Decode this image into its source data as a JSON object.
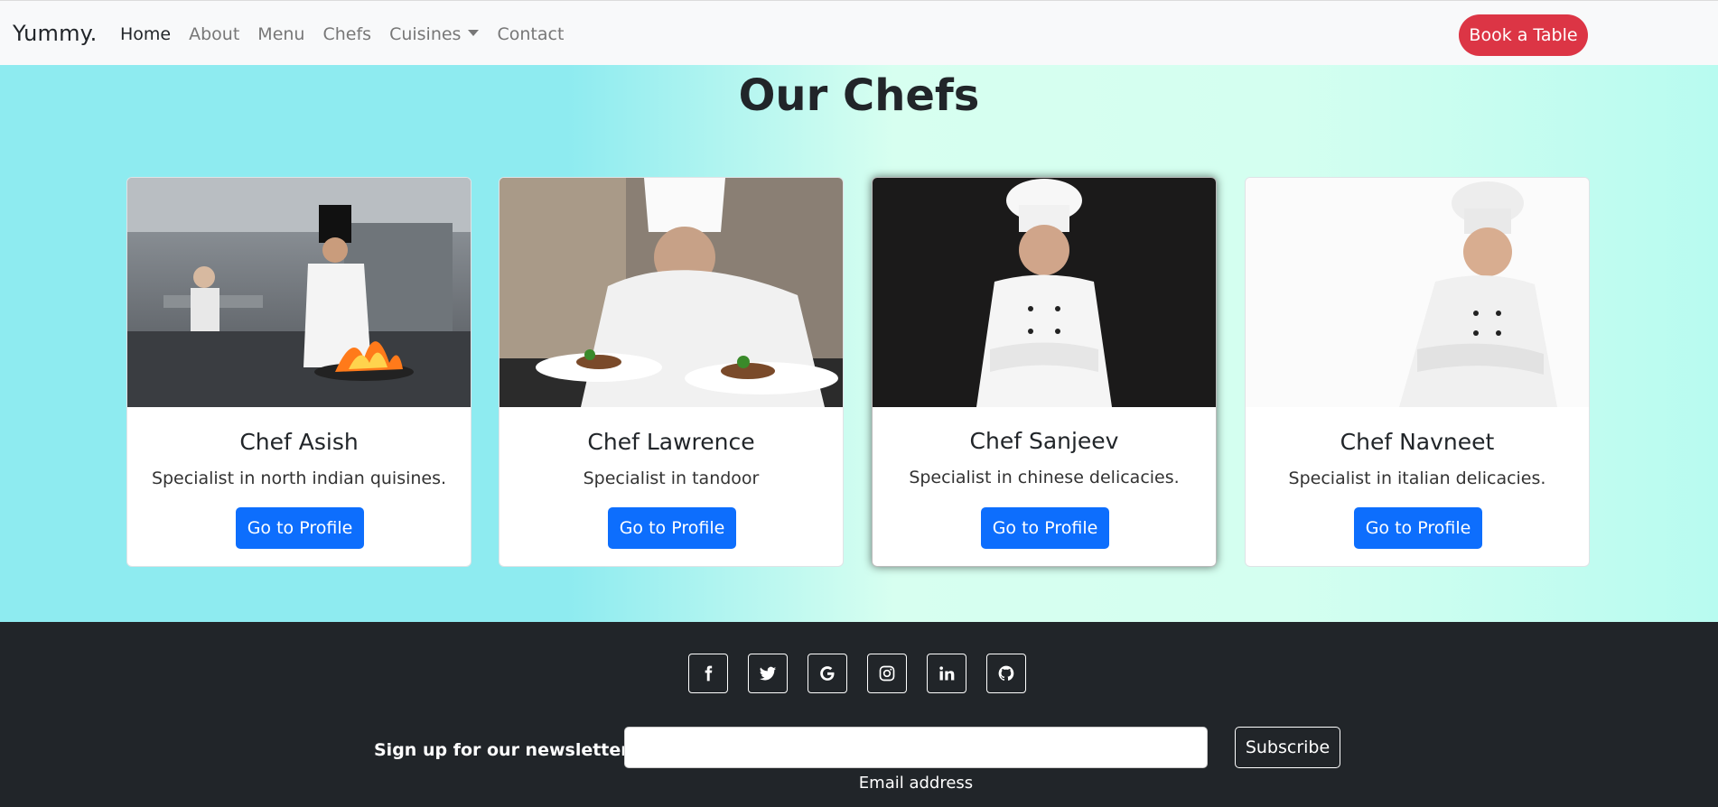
{
  "navbar": {
    "brand": "Yummy.",
    "items": [
      {
        "label": "Home"
      },
      {
        "label": "About"
      },
      {
        "label": "Menu"
      },
      {
        "label": "Chefs"
      },
      {
        "label": "Cuisines"
      },
      {
        "label": "Contact"
      }
    ],
    "book_label": "Book a Table"
  },
  "chefs": {
    "title": "Our Chefs",
    "cards": [
      {
        "name": "Chef Asish",
        "desc": "Specialist in north indian quisines.",
        "button": "Go to Profile",
        "image": "chef cooking with flames in a kitchen"
      },
      {
        "name": "Chef Lawrence",
        "desc": "Specialist in tandoor",
        "button": "Go to Profile",
        "image": "chef plating dishes"
      },
      {
        "name": "Chef Sanjeev",
        "desc": "Specialist in chinese delicacies.",
        "button": "Go to Profile",
        "image": "smiling chef with arms crossed on dark background"
      },
      {
        "name": "Chef Navneet",
        "desc": "Specialist in italian delicacies.",
        "button": "Go to Profile",
        "image": "smiling chef with arms crossed on white background"
      }
    ]
  },
  "footer": {
    "socials": [
      "facebook-icon",
      "twitter-icon",
      "google-icon",
      "instagram-icon",
      "linkedin-icon",
      "github-icon"
    ],
    "newsletter_label": "Sign up for our newsletter",
    "email_value": "",
    "email_label": "Email address",
    "subscribe_label": "Subscribe"
  },
  "colors": {
    "book_button": "#dc3545",
    "profile_button": "#0d6efd",
    "footer_bg": "#212529"
  }
}
